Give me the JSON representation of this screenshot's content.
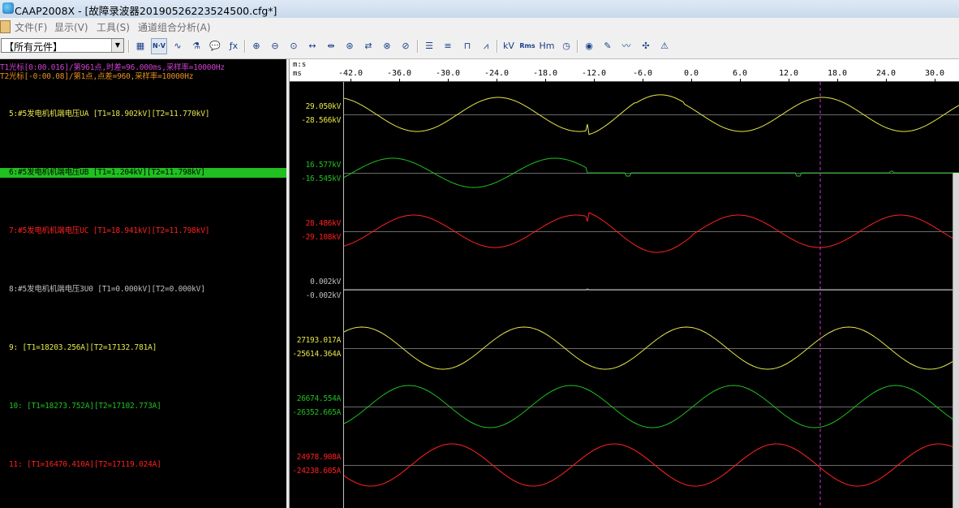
{
  "window": {
    "app_icon": "app-logo-icon",
    "title": "CAAP2008X - [故障录波器20190526223524500.cfg*]"
  },
  "menu": {
    "doc_icon": "document-icon",
    "items": [
      {
        "label": "文件(F)"
      },
      {
        "label": "显示(V)"
      },
      {
        "label": "工具(S)"
      },
      {
        "label": "通道组合分析(A)"
      }
    ]
  },
  "toolbar": {
    "combo_value": "【所有元件】",
    "buttons": [
      {
        "icon": "grid-icon",
        "glyph": "▦"
      },
      {
        "icon": "nv-icon",
        "glyph": "N·V"
      },
      {
        "icon": "wave-select-icon",
        "glyph": "∿"
      },
      {
        "icon": "filter-icon",
        "glyph": "⚗"
      },
      {
        "icon": "comment-icon",
        "glyph": "💬"
      },
      {
        "icon": "function-icon",
        "glyph": "ƒx"
      },
      {
        "icon": "zoom-in-icon",
        "glyph": "⊕"
      },
      {
        "icon": "zoom-out-icon",
        "glyph": "⊖"
      },
      {
        "icon": "zoom-reset-icon",
        "glyph": "⊙"
      },
      {
        "icon": "expand-horizontal-icon",
        "glyph": "↔"
      },
      {
        "icon": "shrink-horizontal-icon",
        "glyph": "⇹"
      },
      {
        "icon": "zoom-fit-icon",
        "glyph": "⊛"
      },
      {
        "icon": "swap-icon",
        "glyph": "⇄"
      },
      {
        "icon": "zoom-x-icon",
        "glyph": "⊗"
      },
      {
        "icon": "zoom-y-icon",
        "glyph": "⊘"
      },
      {
        "icon": "ordered-list-icon",
        "glyph": "☰"
      },
      {
        "icon": "unordered-list-icon",
        "glyph": "≡"
      },
      {
        "icon": "digital-channel-icon",
        "glyph": "⊓"
      },
      {
        "icon": "waveform-icon",
        "glyph": "⩘"
      },
      {
        "icon": "kv-unit-icon",
        "glyph": "kV"
      },
      {
        "icon": "rms-icon",
        "glyph": "Rms"
      },
      {
        "icon": "harmonic-icon",
        "glyph": "Hm"
      },
      {
        "icon": "clock-icon",
        "glyph": "◷"
      },
      {
        "icon": "phasor-icon",
        "glyph": "◉"
      },
      {
        "icon": "pen-icon",
        "glyph": "✎"
      },
      {
        "icon": "trend-icon",
        "glyph": "〰"
      },
      {
        "icon": "compare-icon",
        "glyph": "✣"
      },
      {
        "icon": "fault-locate-icon",
        "glyph": "⚠"
      }
    ]
  },
  "cursor_info": {
    "t1": "T1光标[0:00.016]/第961点,时差=96.000ms,采样率=10000Hz",
    "t2": "T2光标[-0:00.08]/第1点,点差=960,采样率=10000Hz"
  },
  "ruler": {
    "unit_top": "m:s",
    "unit_bottom": "ms",
    "ticks": [
      "-42.0",
      "-36.0",
      "-30.0",
      "-24.0",
      "-18.0",
      "-12.0",
      "-6.0",
      "0.0",
      "6.0",
      "12.0",
      "18.0",
      "24.0",
      "30.0"
    ]
  },
  "channels": [
    {
      "label": "5:#5发电机机端电压UA [T1=18.902kV][T2=11.770kV]",
      "max": "29.050kV",
      "min": "-28.566kV",
      "color": "#e6e64a",
      "selected": false
    },
    {
      "label": "6:#5发电机机端电压UB [T1=1.204kV][T2=11.798kV]",
      "max": "16.577kV",
      "min": "-16.545kV",
      "color": "#20c020",
      "selected": true
    },
    {
      "label": "7:#5发电机机端电压UC [T1=18.941kV][T2=11.798kV]",
      "max": "28.486kV",
      "min": "-29.108kV",
      "color": "#ff2020",
      "selected": false
    },
    {
      "label": "8:#5发电机机端电压3U0 [T1=0.000kV][T2=0.000kV]",
      "max": "0.002kV",
      "min": "-0.002kV",
      "color": "#bfbfbf",
      "selected": false
    },
    {
      "label": "9: [T1=18203.256A][T2=17132.781A]",
      "max": "27193.017A",
      "min": "-25614.364A",
      "color": "#e6e64a",
      "selected": false
    },
    {
      "label": "10: [T1=18273.752A][T2=17102.773A]",
      "max": "26674.554A",
      "min": "-26352.665A",
      "color": "#20c020",
      "selected": false
    },
    {
      "label": "11: [T1=16470.410A][T2=17119.024A]",
      "max": "24978.908A",
      "min": "-24238.605A",
      "color": "#ff2020",
      "selected": false
    }
  ],
  "colors": {
    "cursor_t1": "#cc33cc",
    "cursor_t2": "#e89020",
    "baseline": "#6b6b6b"
  }
}
